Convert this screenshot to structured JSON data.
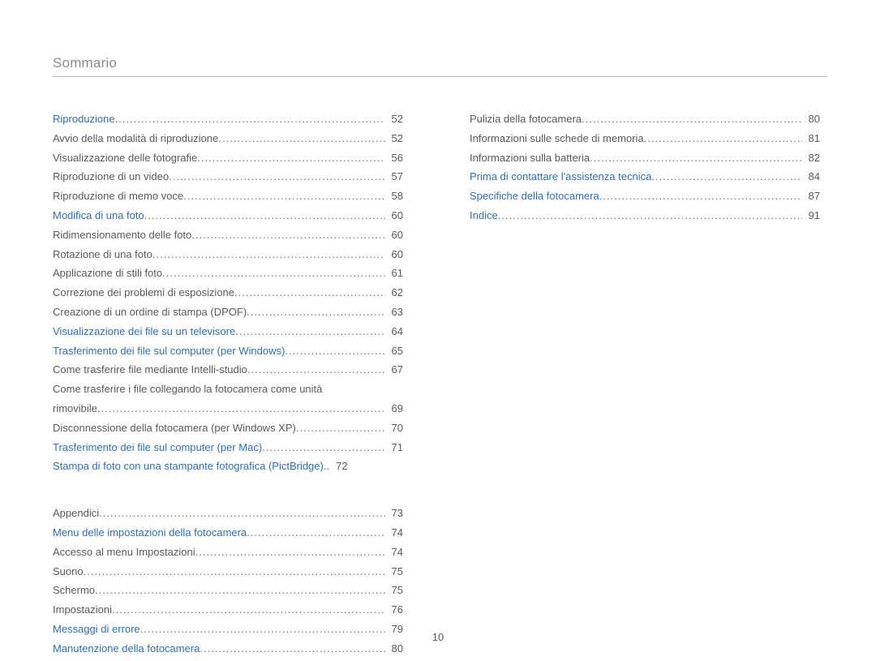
{
  "header": {
    "title": "Sommario"
  },
  "footer": {
    "page": "10"
  },
  "left": [
    {
      "label": "Riproduzione",
      "page": "52",
      "style": "link"
    },
    {
      "label": "Avvio della modalità di riproduzione",
      "page": "52",
      "style": "normal"
    },
    {
      "label": "Visualizzazione delle fotografie",
      "page": "56",
      "style": "normal"
    },
    {
      "label": "Riproduzione di un video",
      "page": "57",
      "style": "normal"
    },
    {
      "label": "Riproduzione di memo voce",
      "page": "58",
      "style": "normal"
    },
    {
      "label": "Modifica di una foto",
      "page": "60",
      "style": "link"
    },
    {
      "label": "Ridimensionamento delle foto",
      "page": "60",
      "style": "normal"
    },
    {
      "label": "Rotazione di una foto",
      "page": "60",
      "style": "normal"
    },
    {
      "label": "Applicazione di stili foto",
      "page": "61",
      "style": "normal"
    },
    {
      "label": "Correzione dei problemi di esposizione",
      "page": "62",
      "style": "normal"
    },
    {
      "label": "Creazione di un ordine di stampa (DPOF)",
      "page": "63",
      "style": "normal"
    },
    {
      "label": "Visualizzazione dei file su un televisore",
      "page": "64",
      "style": "link"
    },
    {
      "label": "Trasferimento dei file sul computer (per Windows)",
      "page": "65",
      "style": "link"
    },
    {
      "label": "Come trasferire file mediante Intelli-studio",
      "page": "67",
      "style": "normal"
    },
    {
      "label_wrap1": "Come trasferire i file collegando la fotocamera come unità",
      "label_wrap2": "rimovibile",
      "page": "69",
      "style": "normal",
      "wrap": true
    },
    {
      "label": "Disconnessione della fotocamera (per Windows XP)",
      "page": "70",
      "style": "normal"
    },
    {
      "label": "Trasferimento dei file sul computer (per Mac)",
      "page": "71",
      "style": "link"
    },
    {
      "label": "Stampa di foto con una stampante fotografica (PictBridge)",
      "page": "72",
      "style": "link",
      "dots_short": true
    },
    {
      "spacer": true
    },
    {
      "label": "Appendici",
      "page": "73",
      "style": "normal"
    },
    {
      "label": "Menu delle impostazioni della fotocamera",
      "page": "74",
      "style": "link"
    },
    {
      "label": "Accesso al menu Impostazioni",
      "page": "74",
      "style": "normal"
    },
    {
      "label": "Suono",
      "page": "75",
      "style": "normal"
    },
    {
      "label": "Schermo",
      "page": "75",
      "style": "normal"
    },
    {
      "label": "Impostazioni",
      "page": "76",
      "style": "normal"
    },
    {
      "label": "Messaggi di errore",
      "page": "79",
      "style": "link"
    },
    {
      "label": "Manutenzione della fotocamera",
      "page": "80",
      "style": "link"
    }
  ],
  "right": [
    {
      "label": "Pulizia della fotocamera",
      "page": "80",
      "style": "normal"
    },
    {
      "label": "Informazioni sulle schede di memoria",
      "page": "81",
      "style": "normal"
    },
    {
      "label": "Informazioni sulla batteria",
      "page": "82",
      "style": "normal"
    },
    {
      "label": "Prima di contattare l'assistenza tecnica",
      "page": "84",
      "style": "link"
    },
    {
      "label": "Specifiche della fotocamera",
      "page": "87",
      "style": "link"
    },
    {
      "label": "Indice",
      "page": "91",
      "style": "link"
    }
  ]
}
